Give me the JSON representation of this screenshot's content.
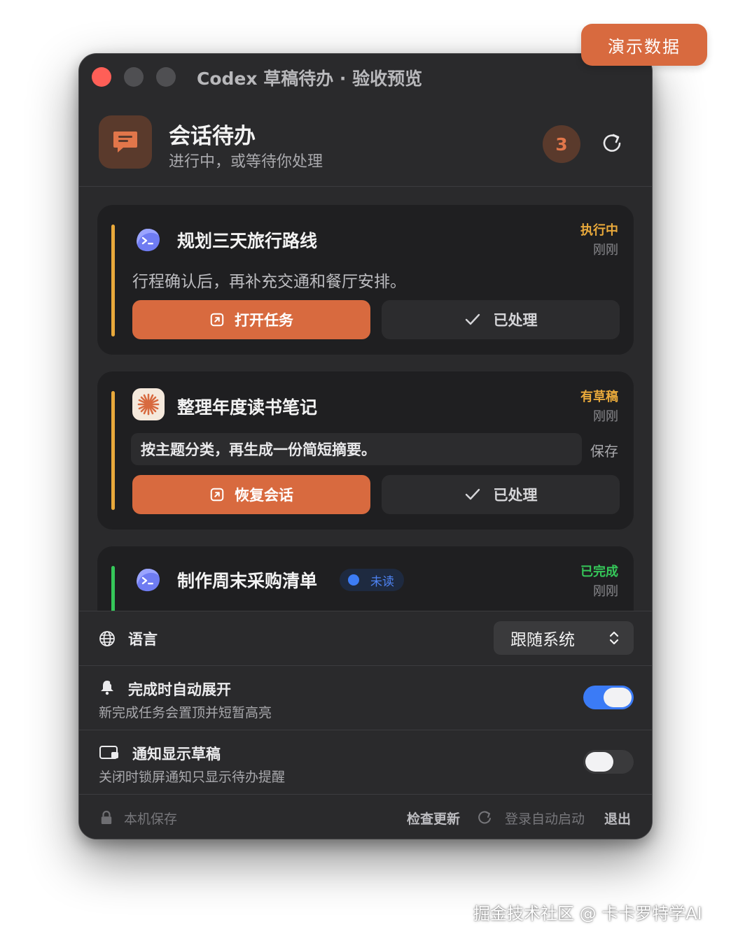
{
  "demo_badge": "演示数据",
  "window": {
    "title": "Codex 草稿待办 · 验收预览"
  },
  "header": {
    "title": "会话待办",
    "subtitle": "进行中，或等待你处理",
    "count": "3"
  },
  "tasks": [
    {
      "title": "规划三天旅行路线",
      "status": "执行中",
      "time": "刚刚",
      "description": "行程确认后，再补充交通和餐厅安排。",
      "primary_label": "打开任务",
      "secondary_label": "已处理",
      "accent": "#e9a93b",
      "status_color": "#e9a93b",
      "icon": "codex-terminal-icon"
    },
    {
      "title": "整理年度读书笔记",
      "status": "有草稿",
      "time": "刚刚",
      "draft_text": "按主题分类，再生成一份简短摘要。",
      "save_label": "保存",
      "primary_label": "恢复会话",
      "secondary_label": "已处理",
      "accent": "#e9a93b",
      "status_color": "#e9a93b",
      "icon": "claude-starburst-icon"
    },
    {
      "title": "制作周末采购清单",
      "badge": "未读",
      "status": "已完成",
      "time": "刚刚",
      "accent": "#35c759",
      "status_color": "#35c759",
      "icon": "codex-terminal-icon"
    }
  ],
  "settings": {
    "language_label": "语言",
    "language_value": "跟随系统",
    "auto_expand": {
      "title": "完成时自动展开",
      "description": "新完成任务会置顶并短暂高亮",
      "enabled": true
    },
    "show_drafts": {
      "title": "通知显示草稿",
      "description": "关闭时锁屏通知只显示待办提醒",
      "enabled": false
    }
  },
  "footer": {
    "local_save": "本机保存",
    "check_update": "检查更新",
    "login_start": "登录自动启动",
    "quit": "退出"
  },
  "watermark": "掘金技术社区 @ 卡卡罗特学AI",
  "colors": {
    "accent": "#d86a3f",
    "toggle_on": "#3b7bf6",
    "window_bg": "#2a2a2c",
    "card_bg": "#1f1f21"
  }
}
